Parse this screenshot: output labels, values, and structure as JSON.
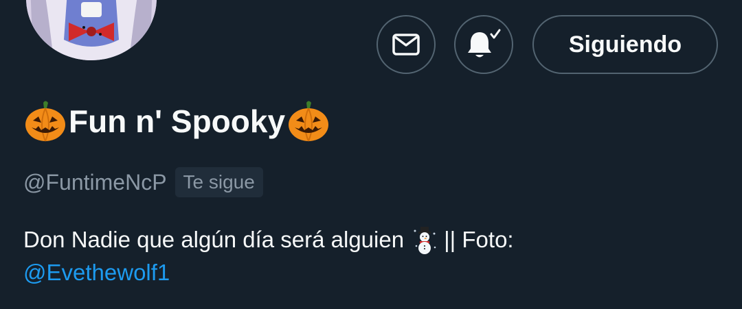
{
  "profile": {
    "display_name": "Fun n' Spooky",
    "handle": "@FuntimeNcP",
    "follows_you_badge": "Te sigue",
    "name_emoji": "jack-o-lantern-icon"
  },
  "actions": {
    "message_icon": "envelope-icon",
    "notifications_icon": "bell-check-icon",
    "follow_label": "Siguiendo"
  },
  "bio": {
    "text_before": "Don Nadie que algún día será alguien",
    "emoji": "snowman-icon",
    "text_after": "|| Foto:",
    "mention": "@Evethewolf1"
  },
  "colors": {
    "background": "#15202b",
    "text": "#f7f9f9",
    "secondary_text": "#8b98a5",
    "link": "#1d9bf0",
    "border": "#536471"
  }
}
